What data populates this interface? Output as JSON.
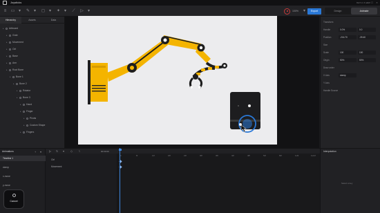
{
  "window": {
    "title": "Joysticks",
    "build": "BETA 0.8.1598"
  },
  "toolbar": {
    "zoom": "100%",
    "export_label": "Export",
    "design_label": "Design",
    "animate_label": "Animate",
    "record_color": "#d84040",
    "accent": "#2a78d6"
  },
  "left_panel": {
    "tabs": [
      "Hierarchy",
      "Assets",
      "Data"
    ],
    "tree": [
      {
        "label": "Artboard",
        "depth": 0
      },
      {
        "label": "Grab",
        "depth": 1
      },
      {
        "label": "Movement",
        "depth": 1
      },
      {
        "label": "Ctrl",
        "depth": 1
      },
      {
        "label": "Base",
        "depth": 1
      },
      {
        "label": "Arm",
        "depth": 1
      },
      {
        "label": "Root Bone",
        "depth": 1
      },
      {
        "label": "Bone 1",
        "depth": 2
      },
      {
        "label": "Bone 2",
        "depth": 3
      },
      {
        "label": "Rotator",
        "depth": 4
      },
      {
        "label": "Bone 3",
        "depth": 4
      },
      {
        "label": "Hand",
        "depth": 5
      },
      {
        "label": "Finger",
        "depth": 5
      },
      {
        "label": "Pivots",
        "depth": 6
      },
      {
        "label": "Custom Shape",
        "depth": 6
      },
      {
        "label": "Fingers",
        "depth": 5
      }
    ]
  },
  "inspector": {
    "rows": [
      {
        "label": "Transform",
        "v1": "",
        "v2": ""
      },
      {
        "label": "Handle",
        "v1": "0.0%",
        "v2": "0.0"
      },
      {
        "label": "Position",
        "v1": "-216.70",
        "v2": "-39.40"
      },
      {
        "label": "Size",
        "v1": "",
        "v2": ""
      },
      {
        "label": "Scale",
        "v1": "100",
        "v2": "100"
      },
      {
        "label": "Origin",
        "v1": "50%",
        "v2": "50%"
      },
      {
        "label": "Draw order",
        "v1": "",
        "v2": ""
      },
      {
        "label": "X Axis",
        "v1": "clamp",
        "v2": ""
      },
      {
        "label": "Y Axis",
        "v1": "",
        "v2": ""
      },
      {
        "label": "Handle Source",
        "v1": "",
        "v2": ""
      }
    ]
  },
  "animations": {
    "header": "Animations",
    "items": [
      "Timeline 1",
      "clamp",
      "x-move",
      "y-move"
    ]
  },
  "timeline": {
    "fps": "00:00:00",
    "ticks": [
      "0",
      "6f",
      "12f",
      "18f",
      "24f",
      "30f",
      "36f",
      "42f",
      "48f",
      "54f",
      "60f",
      "1s6f",
      "1s12f"
    ],
    "keys": [
      "Ctrl",
      "Movement"
    ]
  },
  "interpolation": {
    "header": "Interpolation",
    "empty": "Select a key"
  },
  "overlay": {
    "cancel_label": "Cancel"
  }
}
